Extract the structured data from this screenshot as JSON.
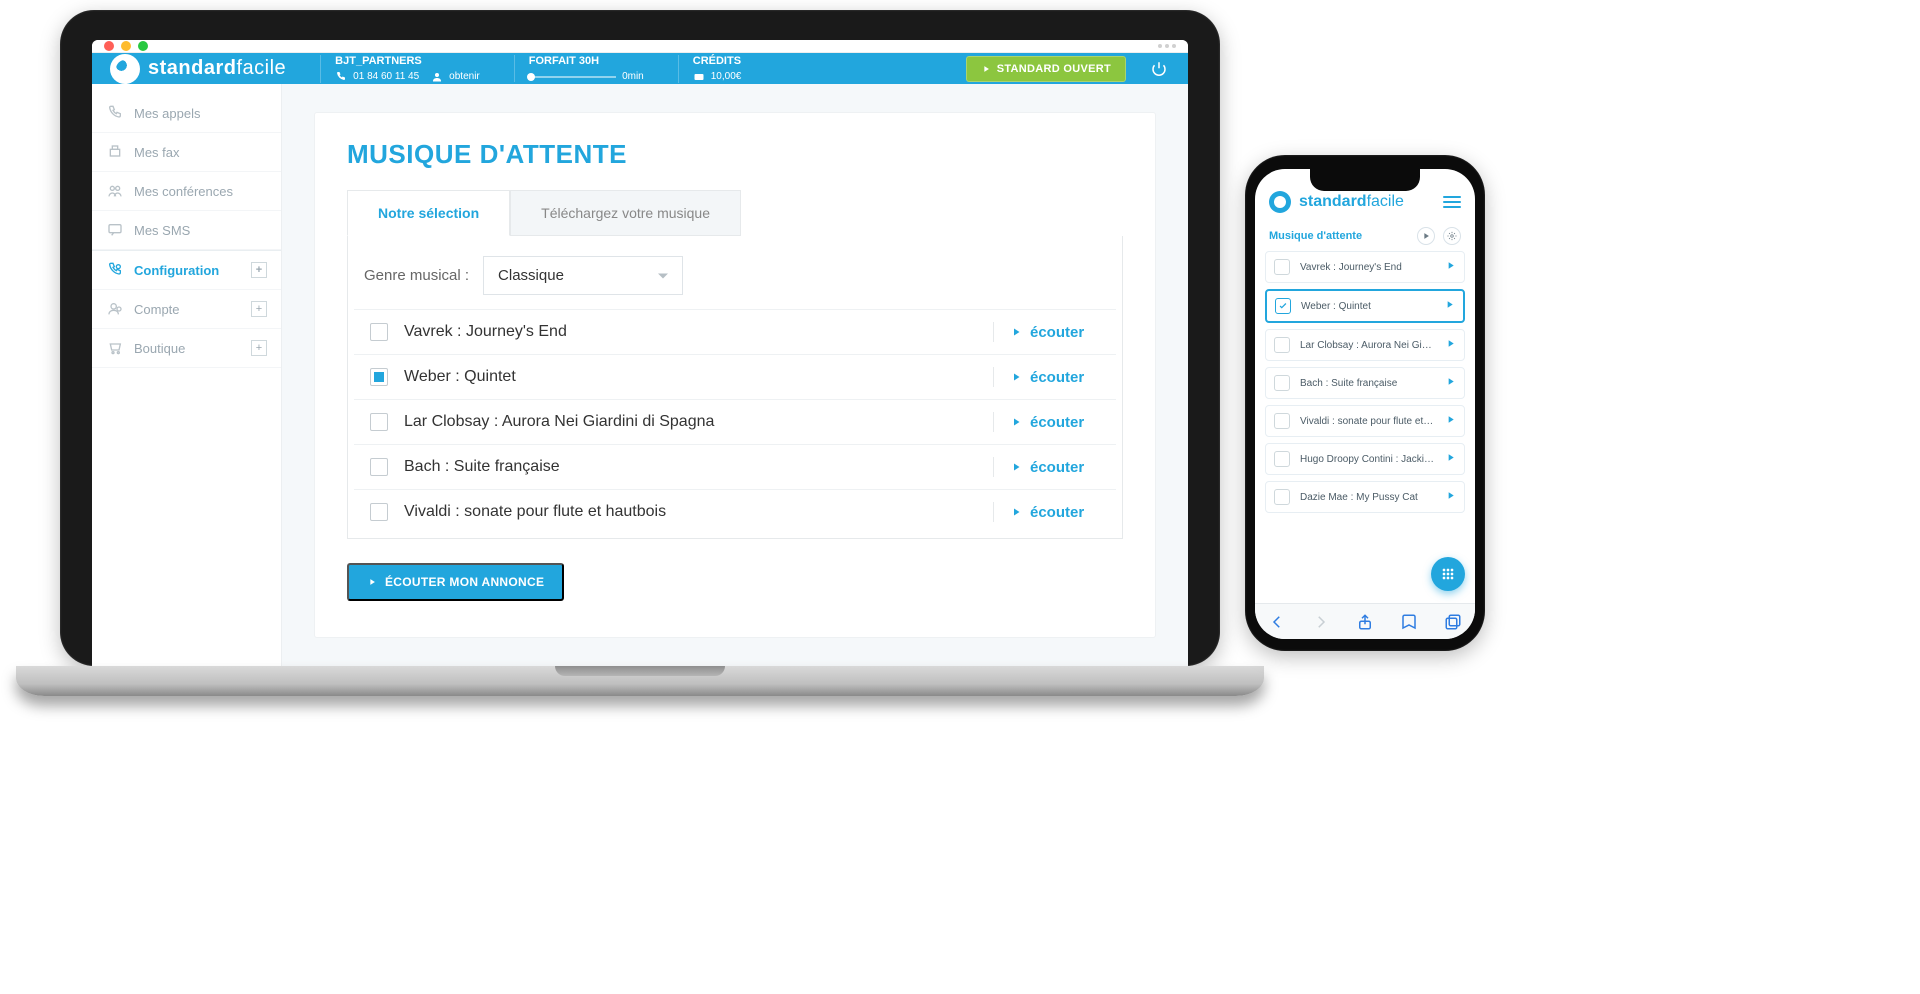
{
  "brand": {
    "bold": "standard",
    "light": "facile"
  },
  "topbar": {
    "partner": {
      "title": "BJT_PARTNERS",
      "phone": "01 84 60 11 45",
      "obtenir": "obtenir"
    },
    "forfait": {
      "title": "FORFAIT 30H",
      "value": "0min"
    },
    "credits": {
      "title": "CRÉDITS",
      "value": "10,00€"
    },
    "status_button": "STANDARD OUVERT"
  },
  "sidebar": {
    "items": [
      {
        "label": "Mes appels"
      },
      {
        "label": "Mes fax"
      },
      {
        "label": "Mes conférences"
      },
      {
        "label": "Mes SMS"
      }
    ],
    "config": {
      "label": "Configuration"
    },
    "compte": {
      "label": "Compte"
    },
    "boutique": {
      "label": "Boutique"
    }
  },
  "content": {
    "title": "MUSIQUE D'ATTENTE",
    "tabs": {
      "selection": "Notre sélection",
      "upload": "Téléchargez votre musique"
    },
    "genre_label": "Genre musical :",
    "genre_value": "Classique",
    "listen_label": "écouter",
    "tracks": [
      {
        "title": "Vavrek : Journey's End",
        "selected": false
      },
      {
        "title": "Weber : Quintet",
        "selected": true
      },
      {
        "title": "Lar Clobsay : Aurora Nei Giardini di Spagna",
        "selected": false
      },
      {
        "title": "Bach : Suite française",
        "selected": false
      },
      {
        "title": "Vivaldi : sonate pour flute et hautbois",
        "selected": false
      }
    ],
    "announce_button": "ÉCOUTER MON ANNONCE"
  },
  "mobile": {
    "section": "Musique d'attente",
    "tracks": [
      {
        "title": "Vavrek : Journey's End",
        "selected": false
      },
      {
        "title": "Weber : Quintet",
        "selected": true
      },
      {
        "title": "Lar Clobsay : Aurora Nei Giardini",
        "selected": false
      },
      {
        "title": "Bach : Suite française",
        "selected": false
      },
      {
        "title": "Vivaldi : sonate pour flute et haut",
        "selected": false
      },
      {
        "title": "Hugo Droopy Contini : Jackies Id",
        "selected": false
      },
      {
        "title": "Dazie Mae : My Pussy Cat",
        "selected": false
      }
    ]
  }
}
